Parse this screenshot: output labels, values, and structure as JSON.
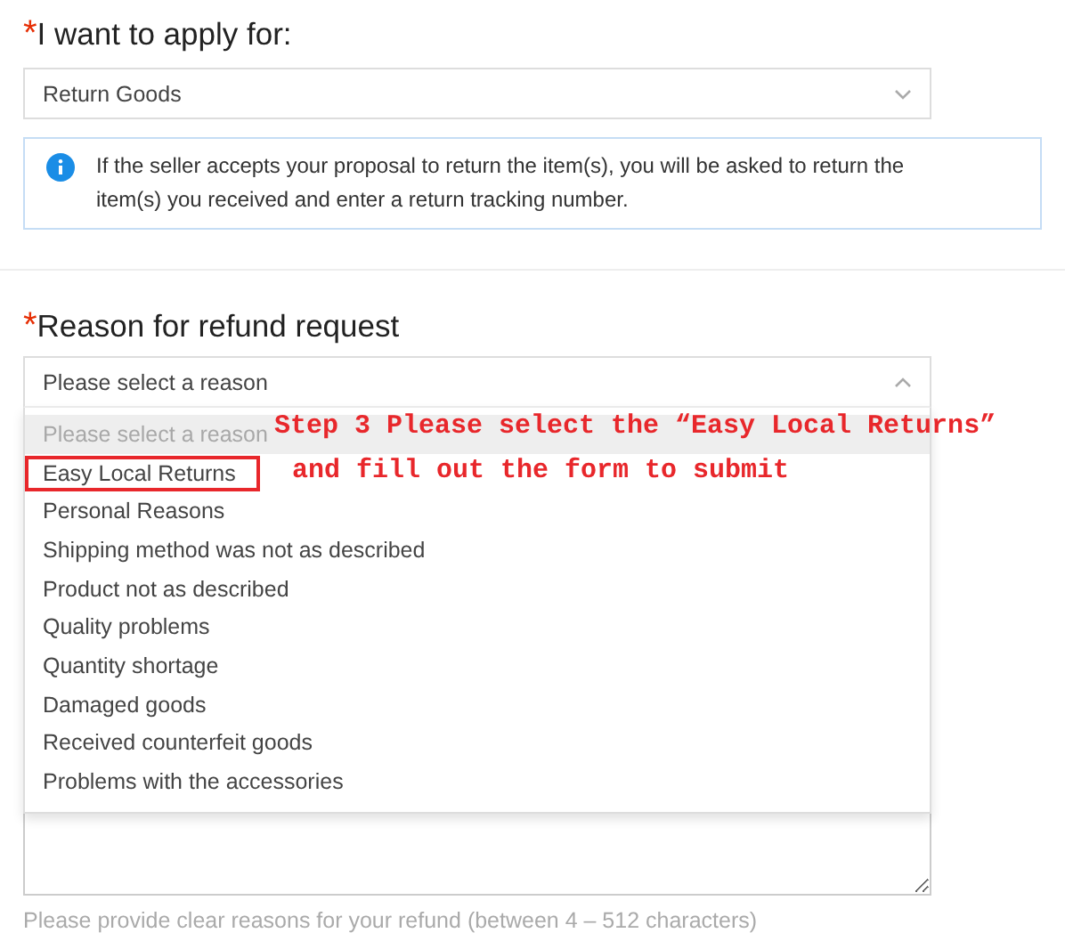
{
  "apply_section": {
    "required_mark": "*",
    "label": "I want to apply for:",
    "select": {
      "value": "Return Goods",
      "expanded": false
    },
    "info": "If the seller accepts your proposal to return the item(s), you will be asked to return the item(s) you received and enter a return tracking number."
  },
  "reason_section": {
    "required_mark": "*",
    "label": "Reason for refund request",
    "select": {
      "placeholder": "Please select a reason",
      "expanded": true
    },
    "options": [
      {
        "label": "Please select a reason",
        "disabled": true,
        "highlighted": true,
        "boxed": false
      },
      {
        "label": "Easy Local Returns",
        "disabled": false,
        "highlighted": false,
        "boxed": true
      },
      {
        "label": "Personal Reasons",
        "disabled": false,
        "highlighted": false,
        "boxed": false
      },
      {
        "label": "Shipping method was not as described",
        "disabled": false,
        "highlighted": false,
        "boxed": false
      },
      {
        "label": "Product not as described",
        "disabled": false,
        "highlighted": false,
        "boxed": false
      },
      {
        "label": "Quality problems",
        "disabled": false,
        "highlighted": false,
        "boxed": false
      },
      {
        "label": "Quantity shortage",
        "disabled": false,
        "highlighted": false,
        "boxed": false
      },
      {
        "label": "Damaged goods",
        "disabled": false,
        "highlighted": false,
        "boxed": false
      },
      {
        "label": "Received counterfeit goods",
        "disabled": false,
        "highlighted": false,
        "boxed": false
      },
      {
        "label": "Problems with the accessories",
        "disabled": false,
        "highlighted": false,
        "boxed": false
      }
    ],
    "hint": "Please provide clear reasons for your refund (between 4 – 512 characters)"
  },
  "annotation": [
    "Step 3 Please select the “Easy Local Returns”",
    "and fill out the form to submit"
  ]
}
